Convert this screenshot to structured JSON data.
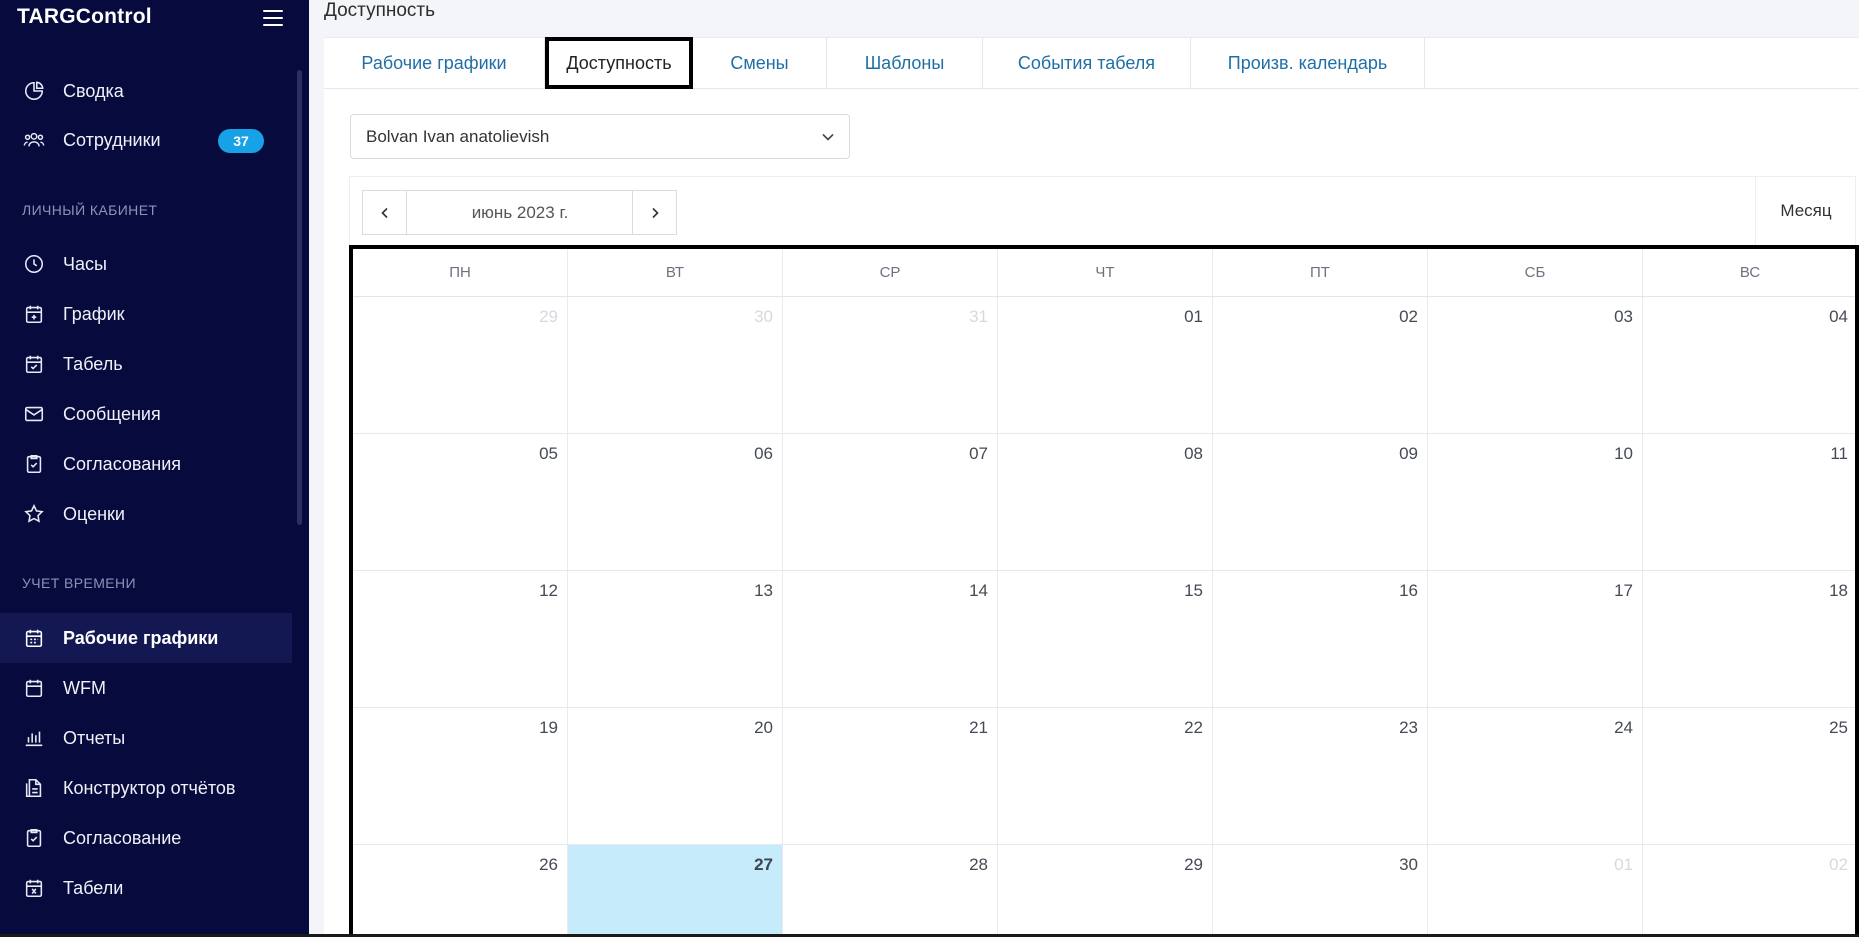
{
  "app": {
    "brand": "TARGControl"
  },
  "sidebar": {
    "top_items": [
      {
        "label": "Сводка",
        "icon": "pie-chart-icon"
      },
      {
        "label": "Сотрудники",
        "icon": "users-icon",
        "badge": "37"
      }
    ],
    "section_personal": "ЛИЧНЫЙ КАБИНЕТ",
    "personal_items": [
      {
        "label": "Часы",
        "icon": "clock-icon"
      },
      {
        "label": "График",
        "icon": "calendar-plus-icon"
      },
      {
        "label": "Табель",
        "icon": "calendar-check-icon"
      },
      {
        "label": "Сообщения",
        "icon": "mail-icon"
      },
      {
        "label": "Согласования",
        "icon": "clipboard-check-icon"
      },
      {
        "label": "Оценки",
        "icon": "star-icon"
      }
    ],
    "section_time": "УЧЕТ ВРЕМЕНИ",
    "time_items": [
      {
        "label": "Рабочие графики",
        "icon": "calendar-grid-icon",
        "active": true
      },
      {
        "label": "WFM",
        "icon": "calendar-icon"
      },
      {
        "label": "Отчеты",
        "icon": "bar-chart-icon"
      },
      {
        "label": "Конструктор отчётов",
        "icon": "report-builder-icon"
      },
      {
        "label": "Согласование",
        "icon": "clipboard-check-icon"
      },
      {
        "label": "Табели",
        "icon": "calendar-x-icon"
      }
    ]
  },
  "page": {
    "title": "Доступность"
  },
  "tabs": [
    {
      "label": "Рабочие графики",
      "active": false
    },
    {
      "label": "Доступность",
      "active": true
    },
    {
      "label": "Смены",
      "active": false
    },
    {
      "label": "Шаблоны",
      "active": false
    },
    {
      "label": "События табеля",
      "active": false
    },
    {
      "label": "Произв. календарь",
      "active": false
    }
  ],
  "employee_select": {
    "value": "Bolvan Ivan anatolievish"
  },
  "calendar": {
    "month_label": "июнь 2023 г.",
    "view_label": "Месяц",
    "weekdays": [
      "ПН",
      "ВТ",
      "СР",
      "ЧТ",
      "ПТ",
      "СБ",
      "ВС"
    ],
    "weeks": [
      [
        {
          "d": "29",
          "other": true
        },
        {
          "d": "30",
          "other": true
        },
        {
          "d": "31",
          "other": true
        },
        {
          "d": "01"
        },
        {
          "d": "02"
        },
        {
          "d": "03"
        },
        {
          "d": "04"
        }
      ],
      [
        {
          "d": "05"
        },
        {
          "d": "06"
        },
        {
          "d": "07"
        },
        {
          "d": "08"
        },
        {
          "d": "09"
        },
        {
          "d": "10"
        },
        {
          "d": "11"
        }
      ],
      [
        {
          "d": "12"
        },
        {
          "d": "13"
        },
        {
          "d": "14"
        },
        {
          "d": "15"
        },
        {
          "d": "16"
        },
        {
          "d": "17"
        },
        {
          "d": "18"
        }
      ],
      [
        {
          "d": "19"
        },
        {
          "d": "20"
        },
        {
          "d": "21"
        },
        {
          "d": "22"
        },
        {
          "d": "23"
        },
        {
          "d": "24"
        },
        {
          "d": "25"
        }
      ],
      [
        {
          "d": "26"
        },
        {
          "d": "27",
          "today": true
        },
        {
          "d": "28"
        },
        {
          "d": "29"
        },
        {
          "d": "30"
        },
        {
          "d": "01",
          "other": true
        },
        {
          "d": "02",
          "other": true
        }
      ]
    ]
  },
  "colors": {
    "sidebar_bg": "#070a3d",
    "accent": "#17a2e8",
    "tab_link": "#1f6fa6",
    "today_bg": "#c6ebfb"
  }
}
